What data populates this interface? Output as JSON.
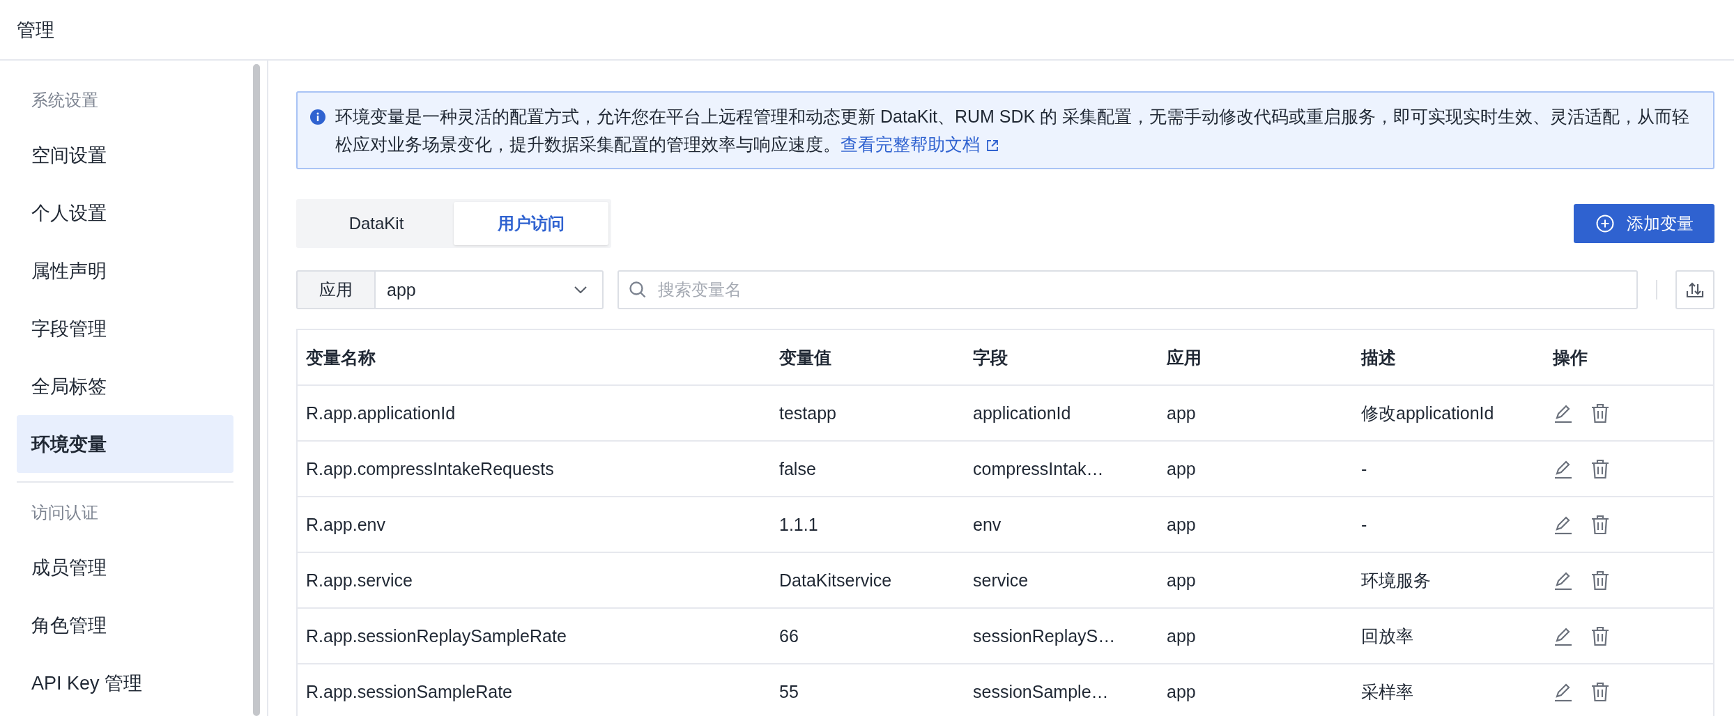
{
  "header": {
    "title": "管理"
  },
  "sidebar": {
    "sections": [
      {
        "label": "系统设置",
        "items": [
          {
            "label": "空间设置",
            "selected": false
          },
          {
            "label": "个人设置",
            "selected": false
          },
          {
            "label": "属性声明",
            "selected": false
          },
          {
            "label": "字段管理",
            "selected": false
          },
          {
            "label": "全局标签",
            "selected": false
          },
          {
            "label": "环境变量",
            "selected": true
          }
        ]
      },
      {
        "label": "访问认证",
        "items": [
          {
            "label": "成员管理",
            "selected": false
          },
          {
            "label": "角色管理",
            "selected": false
          },
          {
            "label": "API Key 管理",
            "selected": false
          }
        ]
      }
    ]
  },
  "banner": {
    "text": "环境变量是一种灵活的配置方式，允许您在平台上远程管理和动态更新 DataKit、RUM SDK 的 采集配置，无需手动修改代码或重启服务，即可实现实时生效、灵活适配，从而轻松应对业务场景变化，提升数据采集配置的管理效率与响应速度。",
    "link": "查看完整帮助文档"
  },
  "tabs": [
    {
      "label": "DataKit",
      "selected": false
    },
    {
      "label": "用户访问",
      "selected": true
    }
  ],
  "add_button": {
    "label": "添加变量"
  },
  "filter": {
    "label": "应用",
    "value": "app",
    "search_placeholder": "搜索变量名"
  },
  "table": {
    "columns": [
      "变量名称",
      "变量值",
      "字段",
      "应用",
      "描述",
      "操作"
    ],
    "rows": [
      {
        "cells": [
          "R.app.applicationId",
          "testapp",
          "applicationId",
          "app",
          "修改applicationId"
        ]
      },
      {
        "cells": [
          "R.app.compressIntakeRequests",
          "false",
          "compressIntak…",
          "app",
          "-"
        ]
      },
      {
        "cells": [
          "R.app.env",
          "1.1.1",
          "env",
          "app",
          "-"
        ]
      },
      {
        "cells": [
          "R.app.service",
          "DataKitservice",
          "service",
          "app",
          "环境服务"
        ]
      },
      {
        "cells": [
          "R.app.sessionReplaySampleRate",
          "66",
          "sessionReplayS…",
          "app",
          "回放率"
        ]
      },
      {
        "cells": [
          "R.app.sessionSampleRate",
          "55",
          "sessionSample…",
          "app",
          "采样率"
        ]
      }
    ]
  }
}
